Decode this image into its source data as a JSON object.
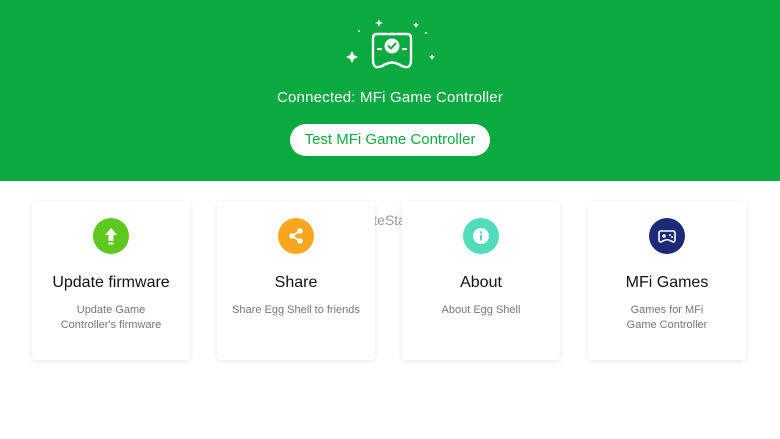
{
  "header": {
    "connected_text": "Connected: MFi Game Controller",
    "test_button_label": "Test MFi Game Controller",
    "background_color": "#0aaa41"
  },
  "watermark": "UpdateStar.com",
  "cards": [
    {
      "title": "Update firmware",
      "desc_line1": "Update Game",
      "desc_line2": "Controller's firmware",
      "icon": "upload-arrow-icon",
      "icon_color": "#5ec81e"
    },
    {
      "title": "Share",
      "desc_line1": "Share Egg Shell to friends",
      "desc_line2": "",
      "icon": "share-icon",
      "icon_color": "#f7a61d"
    },
    {
      "title": "About",
      "desc_line1": "About Egg Shell",
      "desc_line2": "",
      "icon": "info-icon",
      "icon_color": "#51dcbc"
    },
    {
      "title": "MFi Games",
      "desc_line1": "Games for MFi",
      "desc_line2": "Game Controller",
      "icon": "gamepad-icon",
      "icon_color": "#1d2a78"
    }
  ]
}
